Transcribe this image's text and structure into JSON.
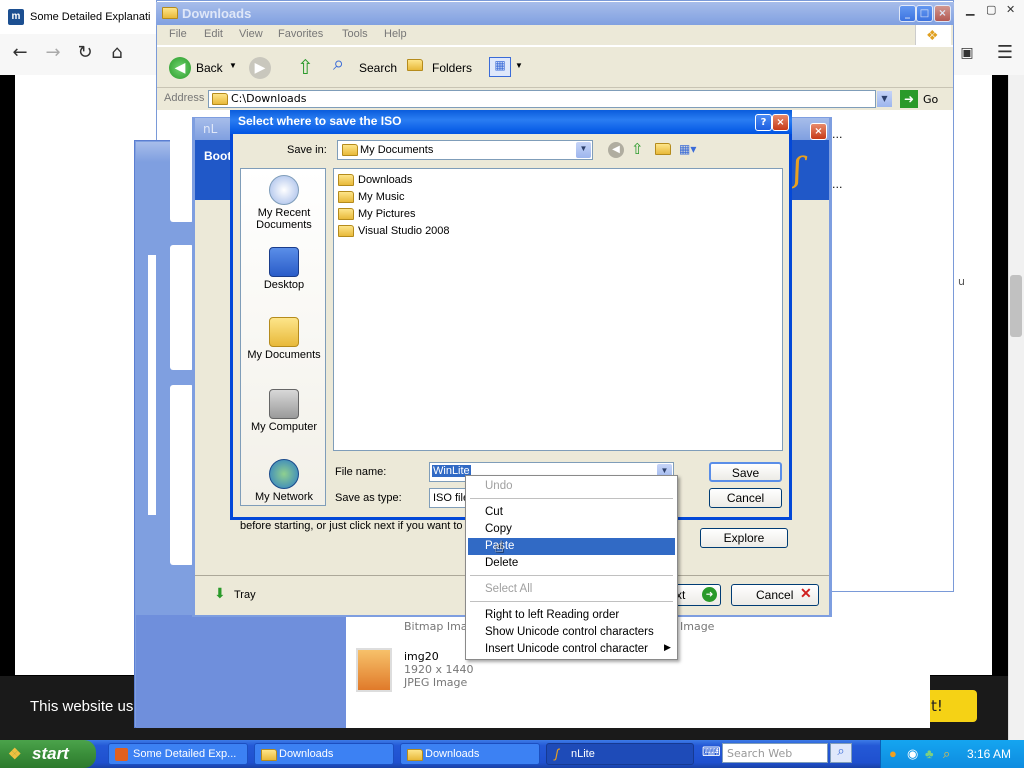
{
  "browser": {
    "tab_title": "Some Detailed Explanati",
    "favicon_letter": "m"
  },
  "cookie": {
    "text": "This website us",
    "button_label": "t!"
  },
  "explorer": {
    "title": "Downloads",
    "menu": [
      "File",
      "Edit",
      "View",
      "Favorites",
      "Tools",
      "Help"
    ],
    "toolbar": {
      "back": "Back",
      "search": "Search",
      "folders": "Folders"
    },
    "address_label": "Address",
    "address_value": "C:\\Downloads",
    "go_label": "Go",
    "dots1": "...",
    "dots2": "...",
    "side_u": "u",
    "items": [
      {
        "name": "Bitmap Image",
        "suffix": "Image"
      },
      {
        "name": "img20",
        "dims": "1920 x 1440",
        "type": "JPEG Image"
      }
    ]
  },
  "nlite": {
    "title": "nL",
    "boot_label": "Boot",
    "tray_label": "Tray",
    "next_label": "xt",
    "cancel_label": "Cancel",
    "explore_label": "Explore",
    "info_text": "before starting, or just click next if you want to m"
  },
  "dialog": {
    "title": "Select where to save the ISO",
    "save_in_label": "Save in:",
    "save_in_value": "My Documents",
    "places": [
      "My Recent Documents",
      "Desktop",
      "My Documents",
      "My Computer",
      "My Network"
    ],
    "files": [
      "Downloads",
      "My Music",
      "My Pictures",
      "Visual Studio 2008"
    ],
    "file_name_label": "File name:",
    "file_name_value": "WinLite",
    "save_type_label": "Save as type:",
    "save_type_value": "ISO file",
    "save_button": "Save",
    "cancel_button": "Cancel"
  },
  "context_menu": {
    "undo": "Undo",
    "cut": "Cut",
    "copy": "Copy",
    "paste": "Paste",
    "delete": "Delete",
    "select_all": "Select All",
    "rtl": "Right to left Reading order",
    "show_unicode": "Show Unicode control characters",
    "insert_unicode": "Insert Unicode control character"
  },
  "taskbar": {
    "start": "start",
    "tasks": [
      "Some Detailed Exp...",
      "Downloads",
      "Downloads",
      "nLite"
    ],
    "search_placeholder": "Search Web",
    "clock": "3:16 AM"
  }
}
